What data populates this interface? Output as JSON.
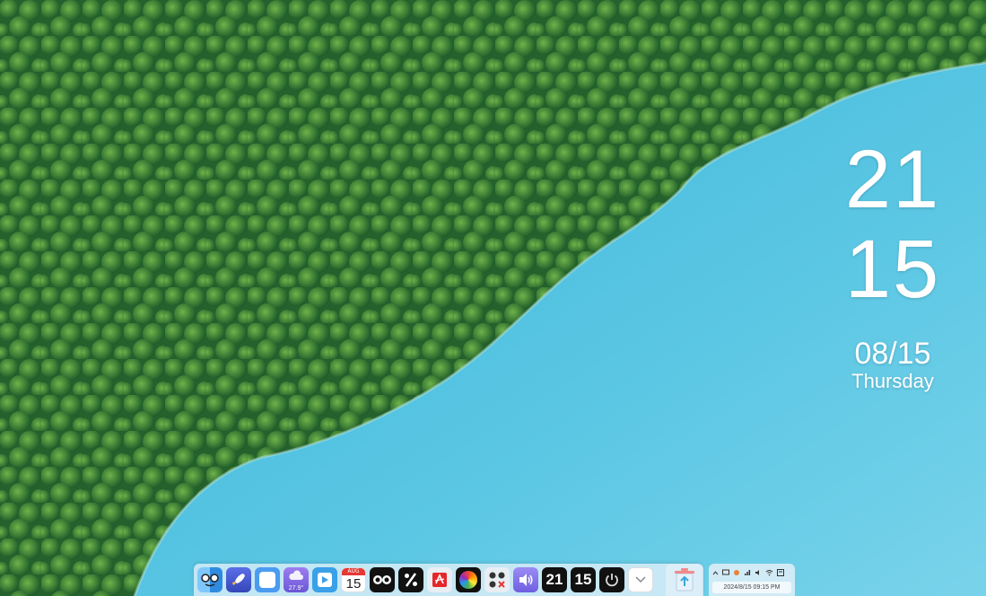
{
  "clock": {
    "hour": "21",
    "minute": "15",
    "date": "08/15",
    "weekday": "Thursday"
  },
  "dock": {
    "items": [
      {
        "name": "finder",
        "icon": "finder-face-icon"
      },
      {
        "name": "launchpad",
        "icon": "rocket-icon"
      },
      {
        "name": "blank-app",
        "icon": "white-square-icon"
      },
      {
        "name": "weather",
        "icon": "cloud-icon",
        "temp": "27.9°"
      },
      {
        "name": "media",
        "icon": "play-icon"
      },
      {
        "name": "calendar",
        "icon": "calendar-icon",
        "month": "AUG",
        "day": "15"
      },
      {
        "name": "owl",
        "icon": "owl-eyes-icon"
      },
      {
        "name": "calculator",
        "icon": "percent-icon"
      },
      {
        "name": "pdf",
        "icon": "pdf-icon"
      },
      {
        "name": "color",
        "icon": "color-wheel-icon"
      },
      {
        "name": "game",
        "icon": "dots-grid-icon"
      },
      {
        "name": "volume",
        "icon": "speaker-icon"
      },
      {
        "name": "clock-hour",
        "icon": "number-tile-icon",
        "text": "21"
      },
      {
        "name": "clock-minute",
        "icon": "number-tile-icon",
        "text": "15"
      },
      {
        "name": "power",
        "icon": "power-icon"
      },
      {
        "name": "more",
        "icon": "chevron-down-icon"
      }
    ],
    "trash_icon": "recycle-bin-icon"
  },
  "tray": {
    "datetime": "2024/8/15 09:15 PM"
  }
}
